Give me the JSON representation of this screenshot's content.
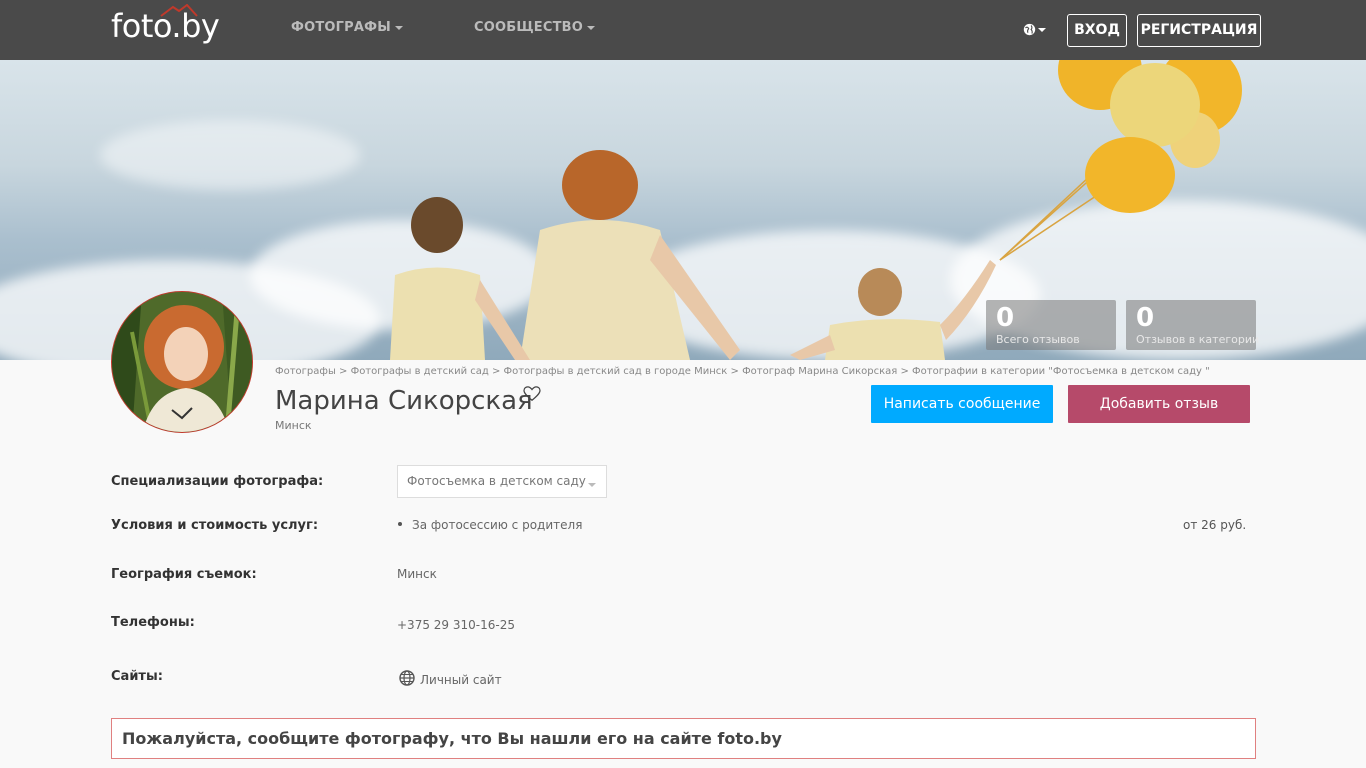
{
  "header": {
    "logo_text": "foto.by",
    "nav": [
      {
        "label": "ФОТОГРАФЫ"
      },
      {
        "label": "СООБЩЕСТВО"
      }
    ],
    "login_label": "ВХОД",
    "register_label": "РЕГИСТРАЦИЯ"
  },
  "stats": [
    {
      "value": "0",
      "label": "Всего отзывов"
    },
    {
      "value": "0",
      "label": "Отзывов в категории"
    }
  ],
  "breadcrumb": "Фотографы > Фотографы в детский сад > Фотографы в детский сад в городе Минск > Фотограф Марина Сикорская > Фотографии в категории \"Фотосъемка в детском саду \"",
  "profile": {
    "name": "Марина Сикорская",
    "city": "Минск",
    "message_button": "Написать сообщение",
    "review_button": "Добавить отзыв"
  },
  "info": {
    "specialization_label": "Специализации фотографа:",
    "specialization_value": "Фотосъемка в детском саду",
    "conditions_label": "Условия и стоимость услуг:",
    "condition_item": "За фотосессию с родителя",
    "condition_price": "от 26 руб.",
    "geo_label": "География съемок:",
    "geo_value": "Минск",
    "phones_label": "Телефоны:",
    "phone_value": "+375 29 310-16-25",
    "sites_label": "Сайты:",
    "site_value": "Личный сайт"
  },
  "notice": "Пожалуйста, сообщите фотографу, что Вы нашли его на сайте foto.by",
  "colors": {
    "topbar": "#4a4a4a",
    "message_button": "#00aaff",
    "review_button": "#b64a6a",
    "notice_border": "#e08080"
  }
}
